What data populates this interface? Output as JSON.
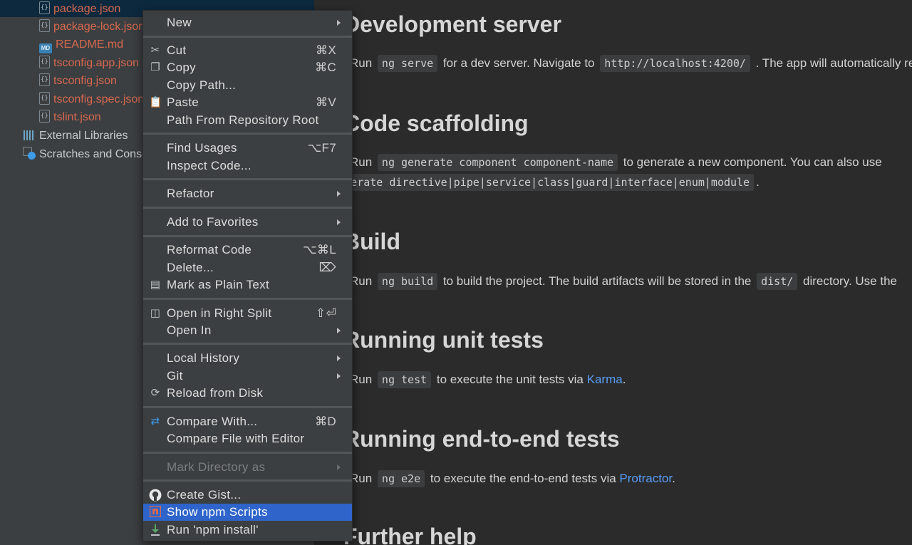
{
  "tree": {
    "files": [
      {
        "name": "package.json",
        "icon": "json-file-icon",
        "color": "#d6684f"
      },
      {
        "name": "package-lock.json",
        "icon": "json-file-icon",
        "color": "#d6684f"
      },
      {
        "name": "README.md",
        "icon": "markdown-file-icon",
        "color": "#d6684f"
      },
      {
        "name": "tsconfig.app.json",
        "icon": "json-file-icon",
        "color": "#d6684f"
      },
      {
        "name": "tsconfig.json",
        "icon": "json-file-icon",
        "color": "#d6684f"
      },
      {
        "name": "tsconfig.spec.json",
        "icon": "json-file-icon",
        "color": "#d6684f"
      },
      {
        "name": "tslint.json",
        "icon": "json-file-icon",
        "color": "#d6684f"
      }
    ],
    "external_libraries": "External Libraries",
    "scratches": "Scratches and Consoles"
  },
  "preview": {
    "sections": [
      {
        "heading": "Development server",
        "lines": [
          {
            "pre": "Run",
            "code": "ng serve",
            "post": "for a dev server. Navigate to",
            "code2": "http://localhost:4200/",
            "post2": ". The app will automatically reload if you change any of the source files."
          }
        ]
      },
      {
        "heading": "Code scaffolding",
        "lines": [
          {
            "pre": "Run",
            "code": "ng generate component component-name",
            "post": "to generate a new component. You can also use"
          },
          {
            "code": "ng generate directive|pipe|service|class|guard|interface|enum|module",
            "post": "."
          }
        ]
      },
      {
        "heading": "Build",
        "lines": [
          {
            "pre": "Run",
            "code": "ng build",
            "post": "to build the project. The build artifacts will be stored in the",
            "code2": "dist/",
            "post2": "directory. Use the"
          }
        ]
      },
      {
        "heading": "Running unit tests",
        "lines": [
          {
            "pre": "Run",
            "code": "ng test",
            "post": "to execute the unit tests via",
            "link": "Karma",
            "post2": "."
          }
        ]
      },
      {
        "heading": "Running end-to-end tests",
        "lines": [
          {
            "pre": "Run",
            "code": "ng e2e",
            "post": "to execute the end-to-end tests via",
            "link": "Protractor",
            "post2": "."
          }
        ]
      },
      {
        "heading": "Further help",
        "lines": []
      }
    ]
  },
  "menu": {
    "highlight_color": "#2f65ca",
    "groups": [
      [
        {
          "label": "New",
          "submenu": true
        }
      ],
      [
        {
          "label": "Cut",
          "shortcut": "⌘X",
          "icon": "scissors-icon"
        },
        {
          "label": "Copy",
          "shortcut": "⌘C",
          "icon": "copy-icon"
        },
        {
          "label": "Copy Path..."
        },
        {
          "label": "Paste",
          "shortcut": "⌘V",
          "icon": "clipboard-icon"
        },
        {
          "label": "Path From Repository Root"
        }
      ],
      [
        {
          "label": "Find Usages",
          "shortcut": "⌥F7"
        },
        {
          "label": "Inspect Code..."
        }
      ],
      [
        {
          "label": "Refactor",
          "submenu": true
        }
      ],
      [
        {
          "label": "Add to Favorites",
          "submenu": true
        }
      ],
      [
        {
          "label": "Reformat Code",
          "shortcut": "⌥⌘L"
        },
        {
          "label": "Delete...",
          "shortcut": "⌦"
        },
        {
          "label": "Mark as Plain Text",
          "icon": "plain-text-icon"
        }
      ],
      [
        {
          "label": "Open in Right Split",
          "shortcut": "⇧⏎",
          "icon": "split-icon"
        },
        {
          "label": "Open In",
          "submenu": true
        }
      ],
      [
        {
          "label": "Local History",
          "submenu": true
        },
        {
          "label": "Git",
          "submenu": true
        },
        {
          "label": "Reload from Disk",
          "icon": "reload-icon"
        }
      ],
      [
        {
          "label": "Compare With...",
          "shortcut": "⌘D",
          "icon": "compare-icon"
        },
        {
          "label": "Compare File with Editor"
        }
      ],
      [
        {
          "label": "Mark Directory as",
          "submenu": true,
          "disabled": true
        }
      ],
      [
        {
          "label": "Create Gist...",
          "icon": "github-icon"
        },
        {
          "label": "Show npm Scripts",
          "icon": "npm-icon",
          "highlighted": true
        },
        {
          "label": "Run 'npm install'",
          "icon": "download-icon"
        }
      ]
    ]
  }
}
